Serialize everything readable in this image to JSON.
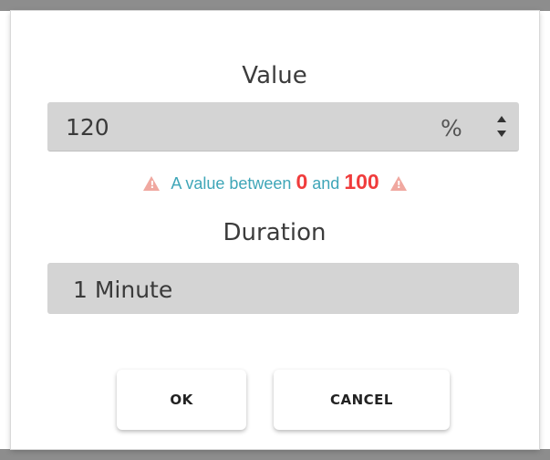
{
  "dialog": {
    "value_label": "Value",
    "value_input": "120",
    "unit": "%",
    "hint": {
      "prefix": "A value between",
      "min": "0",
      "connector": "and",
      "max": "100"
    },
    "duration_label": "Duration",
    "duration_value": "1 Minute",
    "ok_label": "OK",
    "cancel_label": "CANCEL"
  },
  "colors": {
    "field_bg": "#d4d4d4",
    "hint_text": "#3fa6b8",
    "hint_number": "#f03c3c",
    "warning_icon": "#f0a8a0"
  }
}
